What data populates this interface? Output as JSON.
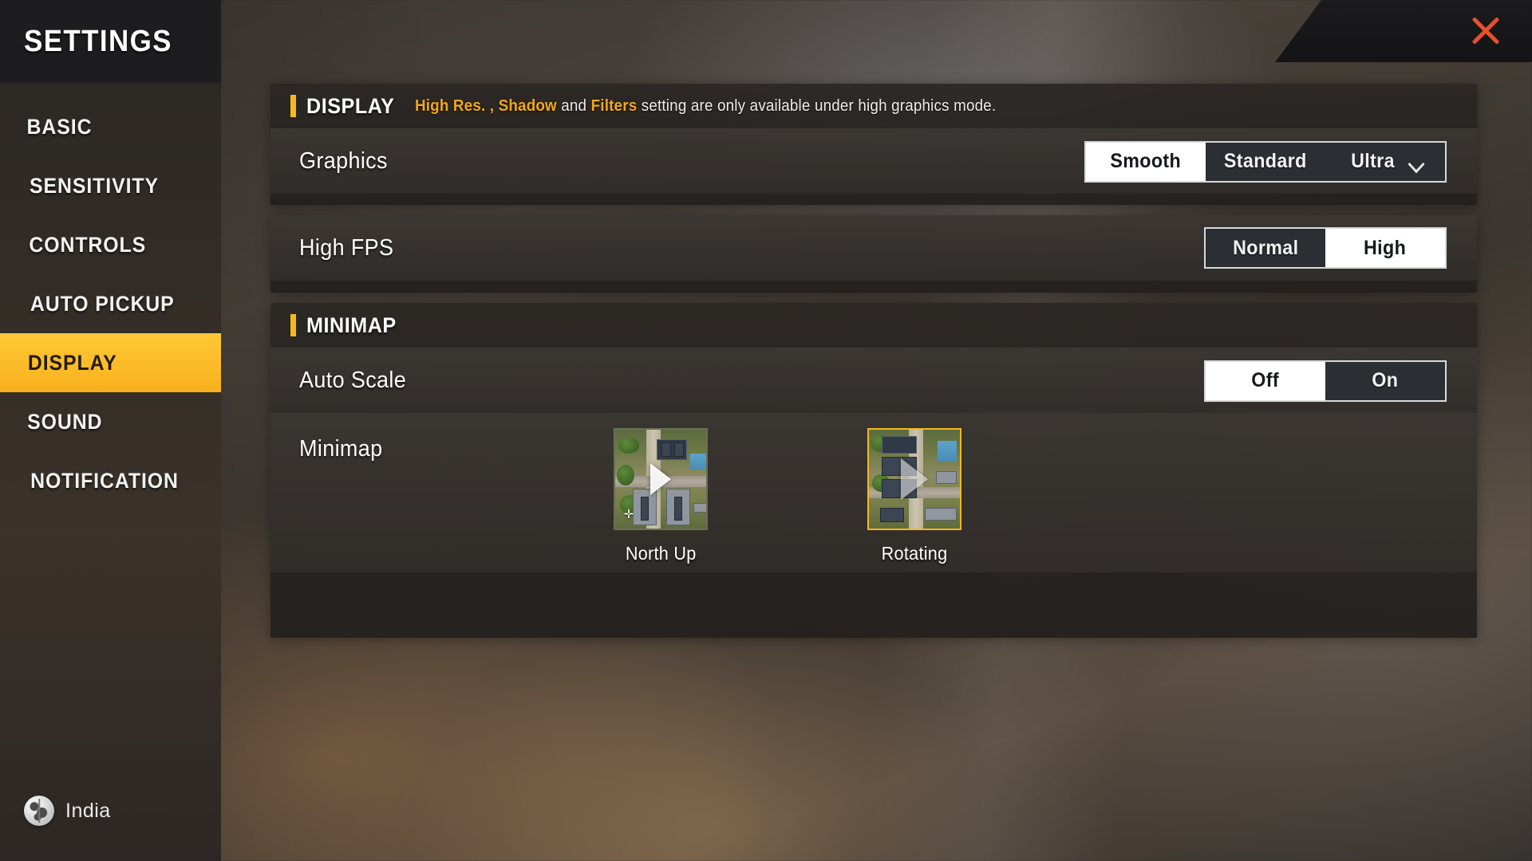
{
  "sidebar": {
    "title": "SETTINGS",
    "items": [
      {
        "id": "basic",
        "label": "BASIC",
        "active": false
      },
      {
        "id": "sensitivity",
        "label": "SENSITIVITY",
        "active": false
      },
      {
        "id": "controls",
        "label": "CONTROLS",
        "active": false
      },
      {
        "id": "auto-pickup",
        "label": "AUTO PICKUP",
        "active": false
      },
      {
        "id": "display",
        "label": "DISPLAY",
        "active": true
      },
      {
        "id": "sound",
        "label": "SOUND",
        "active": false
      },
      {
        "id": "notification",
        "label": "NOTIFICATION",
        "active": false
      }
    ],
    "locale": {
      "icon": "globe-icon",
      "label": "India"
    }
  },
  "header": {
    "close_icon": "close-icon"
  },
  "display_section": {
    "title": "DISPLAY",
    "note_parts": {
      "hl1": "High Res. ,",
      "hl2": "Shadow",
      "mid": " and ",
      "hl3": "Filters",
      "tail": " setting are only available under high graphics mode."
    },
    "note_full": "High Res. , Shadow and Filters setting are only available under high graphics mode.",
    "rows": [
      {
        "label": "Graphics",
        "options": [
          "Smooth",
          "Standard",
          "Ultra"
        ],
        "selected": "Smooth",
        "has_dropdown": true,
        "dropdown_icon": "chevron-down-icon"
      }
    ]
  },
  "fps_section": {
    "rows": [
      {
        "label": "High FPS",
        "options": [
          "Normal",
          "High"
        ],
        "selected": "High"
      }
    ]
  },
  "minimap_section": {
    "title": "MINIMAP",
    "rows": [
      {
        "label": "Auto Scale",
        "options": [
          "Off",
          "On"
        ],
        "selected": "Off"
      }
    ],
    "chooser": {
      "label": "Minimap",
      "choices": [
        {
          "id": "north-up",
          "label": "North Up",
          "selected": false
        },
        {
          "id": "rotating",
          "label": "Rotating",
          "selected": true
        }
      ]
    }
  },
  "colors": {
    "accent_yellow": "#f6b91d",
    "accent_orange": "#f3a71a",
    "close_red": "#e8502a",
    "selected_bg": "#ffffff",
    "selected_text": "#16181b",
    "panel_bg": "#2a2623",
    "sidebar_head": "#1d1d1f"
  }
}
